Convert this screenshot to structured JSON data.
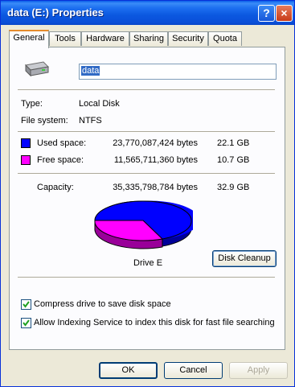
{
  "window": {
    "title": "data (E:) Properties",
    "help_icon": "?",
    "close_icon": "×"
  },
  "tabs": [
    "General",
    "Tools",
    "Hardware",
    "Sharing",
    "Security",
    "Quota"
  ],
  "general": {
    "drive_label_value": "data",
    "type_label": "Type:",
    "type_value": "Local Disk",
    "fs_label": "File system:",
    "fs_value": "NTFS",
    "used": {
      "label": "Used space:",
      "bytes": "23,770,087,424 bytes",
      "size": "22.1 GB",
      "color": "#0000ff"
    },
    "free": {
      "label": "Free space:",
      "bytes": "11,565,711,360 bytes",
      "size": "10.7 GB",
      "color": "#ff00ff"
    },
    "capacity": {
      "label": "Capacity:",
      "bytes": "35,335,798,784 bytes",
      "size": "32.9 GB"
    },
    "drive_caption": "Drive E",
    "disk_cleanup_label": "Disk Cleanup",
    "compress_label": "Compress drive to save disk space",
    "compress_checked": true,
    "indexing_label": "Allow Indexing Service to index this disk for fast file searching",
    "indexing_checked": true
  },
  "footer": {
    "ok": "OK",
    "cancel": "Cancel",
    "apply": "Apply"
  }
}
